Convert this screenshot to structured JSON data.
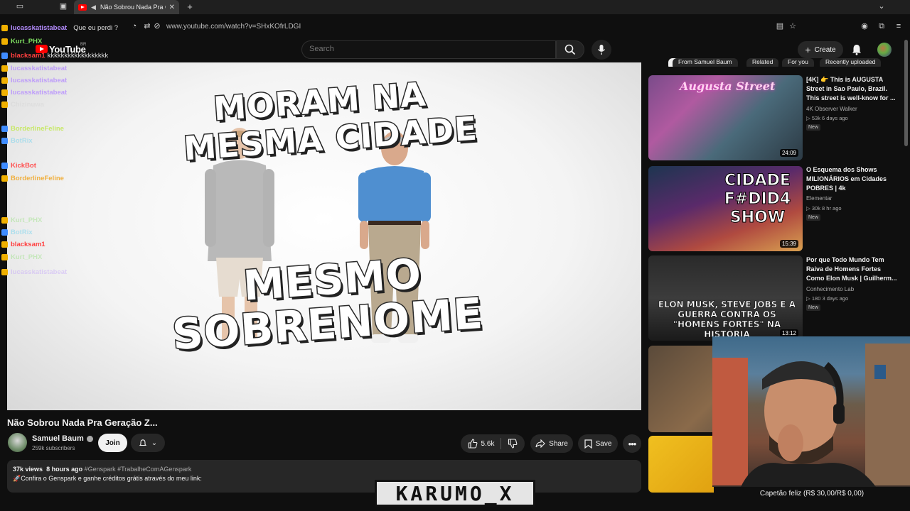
{
  "browser": {
    "tab_title": "Não Sobrou Nada Pra Geração Z",
    "url": "www.youtube.com/watch?v=SHxKOfrLDGI"
  },
  "header": {
    "logo": "YouTube",
    "region": "BR",
    "search_placeholder": "Search",
    "create_label": "Create"
  },
  "chat": [
    {
      "name": "lucasskatistabeat",
      "msg": "Que eu perdi ?",
      "color": "#b58cff",
      "badge": "#f0b000"
    },
    {
      "name": "Kurt_PHX",
      "msg": "",
      "color": "#7ddc5f",
      "badge": "#f0b000"
    },
    {
      "name": "blacksam1",
      "msg": "kkkkkkkkkkkkkkkkkk",
      "color": "#ff4040",
      "badge": "#3f8cff"
    },
    {
      "name": "lucasskatistabeat",
      "msg": "",
      "color": "#b58cff",
      "badge": "#f0b000"
    },
    {
      "name": "lucasskatistabeat",
      "msg": "",
      "color": "#b58cff",
      "badge": "#f0b000"
    },
    {
      "name": "lucasskatistabeat",
      "msg": "",
      "color": "#b58cff",
      "badge": "#f0b000"
    },
    {
      "name": "Chizinuwa",
      "msg": "",
      "color": "#cfcfcf",
      "badge": "#f0b000"
    },
    {
      "name": "BorderlineFeline",
      "msg": "",
      "color": "#c8e86a",
      "badge": "#3f8cff"
    },
    {
      "name": "BotRix",
      "msg": "",
      "color": "#3cc8f0",
      "badge": "#3f8cff"
    },
    {
      "name": "KickBot",
      "msg": "",
      "color": "#ff5050",
      "badge": "#3f8cff"
    },
    {
      "name": "BorderlineFeline",
      "msg": "",
      "color": "#f0b040",
      "badge": "#f0b000"
    },
    {
      "name": "Kurt_PHX",
      "msg": "",
      "color": "#7ddc5f",
      "badge": "#f0b000"
    },
    {
      "name": "BotRix",
      "msg": "",
      "color": "#3cc8f0",
      "badge": "#3f8cff"
    },
    {
      "name": "blacksam1",
      "msg": "",
      "color": "#ff4040",
      "badge": "#f0b000"
    },
    {
      "name": "Kurt_PHX",
      "msg": "",
      "color": "#7ddc5f",
      "badge": "#f0b000"
    },
    {
      "name": "lucasskatistabeat",
      "msg": "",
      "color": "#b58cff",
      "badge": "#f0b000"
    }
  ],
  "thumbnail": {
    "line1": "MORAM NA",
    "line2": "MESMA CIDADE",
    "line3": "MESMO",
    "line4": "SOBRENOME"
  },
  "video": {
    "title": "Não Sobrou Nada Pra Geração Z...",
    "channel": "Samuel Baum",
    "subscribers": "259k subscribers",
    "join_label": "Join",
    "likes": "5.6k",
    "share_label": "Share",
    "save_label": "Save",
    "views": "37k views",
    "uploaded": "8 hours ago",
    "tags": "#Genspark #TrabalheComAGenspark",
    "description": "🚀Confira o Genspark e ganhe créditos grátis através do meu link:"
  },
  "chips": [
    "All",
    "From Samuel Baum",
    "Related",
    "For you",
    "Recently uploaded"
  ],
  "recommendations": [
    {
      "title": "[4K] 👉 This is AUGUSTA Street in Sao Paulo, Brazil. This street is well-know for ...",
      "channel": "4K Observer Walker",
      "stats": "▷ 53k  6 days ago",
      "badge": "New",
      "duration": "24:09",
      "thumb_label": "Augusta Street"
    },
    {
      "title": "O Esquema dos Shows MILIONÁRIOS em Cidades POBRES | 4k",
      "channel": "Elementar",
      "stats": "▷ 30k  8 hr ago",
      "badge": "New",
      "duration": "15:39",
      "thumb_label": "CIDADE F#DID4 SHOW"
    },
    {
      "title": "Por que Todo Mundo Tem Raiva de Homens Fortes Como Elon Musk | Guilherm...",
      "channel": "Conhecimento Lab",
      "stats": "▷ 180  3 days ago",
      "badge": "New",
      "duration": "13:12",
      "thumb_label": "ELON MUSK, STEVE JOBS E A GUERRA CONTRA OS \"HOMENS FORTES\" NA HISTÓRIA"
    }
  ],
  "overlay": {
    "donation": "Capetão feliz (R$ 30,00/R$ 0,00)",
    "streamer": "KARUMO_X"
  }
}
